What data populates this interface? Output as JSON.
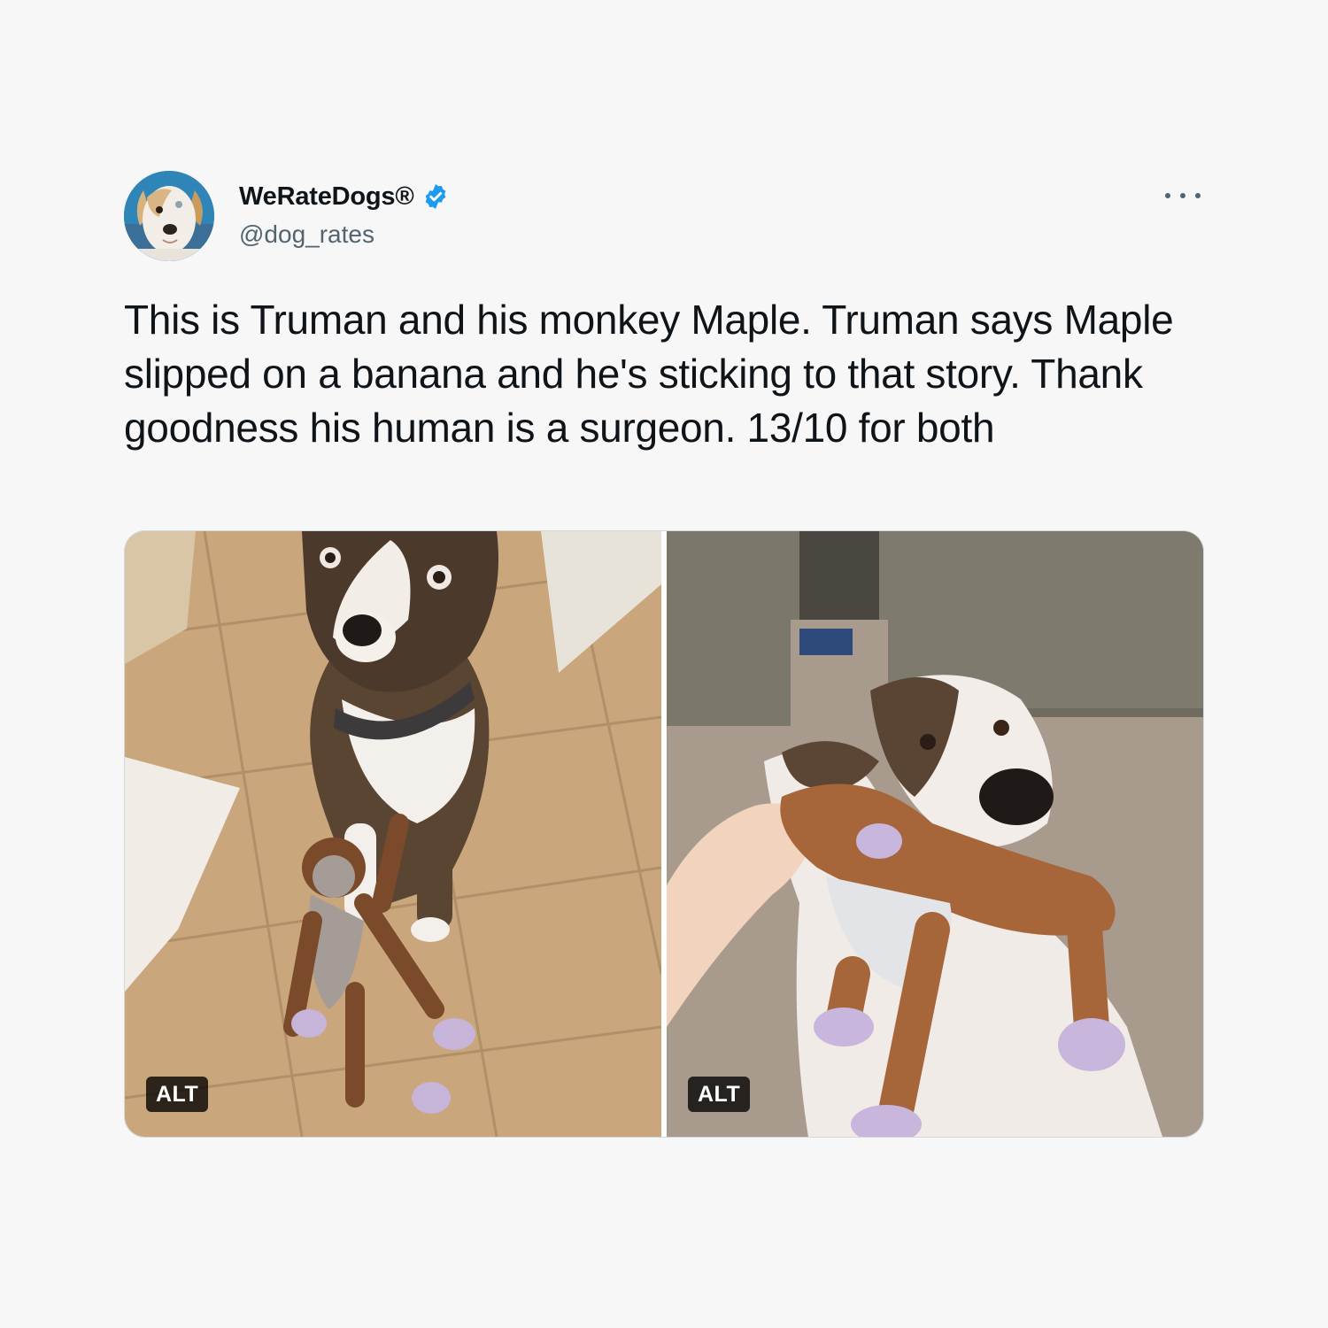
{
  "author": {
    "display_name": "WeRateDogs®",
    "handle": "@dog_rates",
    "verified": true,
    "verified_color": "#1d9bf0",
    "avatar": "dog-profile-photo"
  },
  "tweet": {
    "text": "This is Truman and his monkey Maple. Truman says Maple slipped on a banana and he's sticking to that story. Thank goodness his human is a surgeon. 13/10 for both"
  },
  "more_icon": "more-horizontal-icon",
  "media": [
    {
      "subject": "dog-sitting-with-torn-monkey-toy",
      "alt_label": "ALT"
    },
    {
      "subject": "dog-holding-repaired-monkey-toy",
      "alt_label": "ALT"
    }
  ]
}
